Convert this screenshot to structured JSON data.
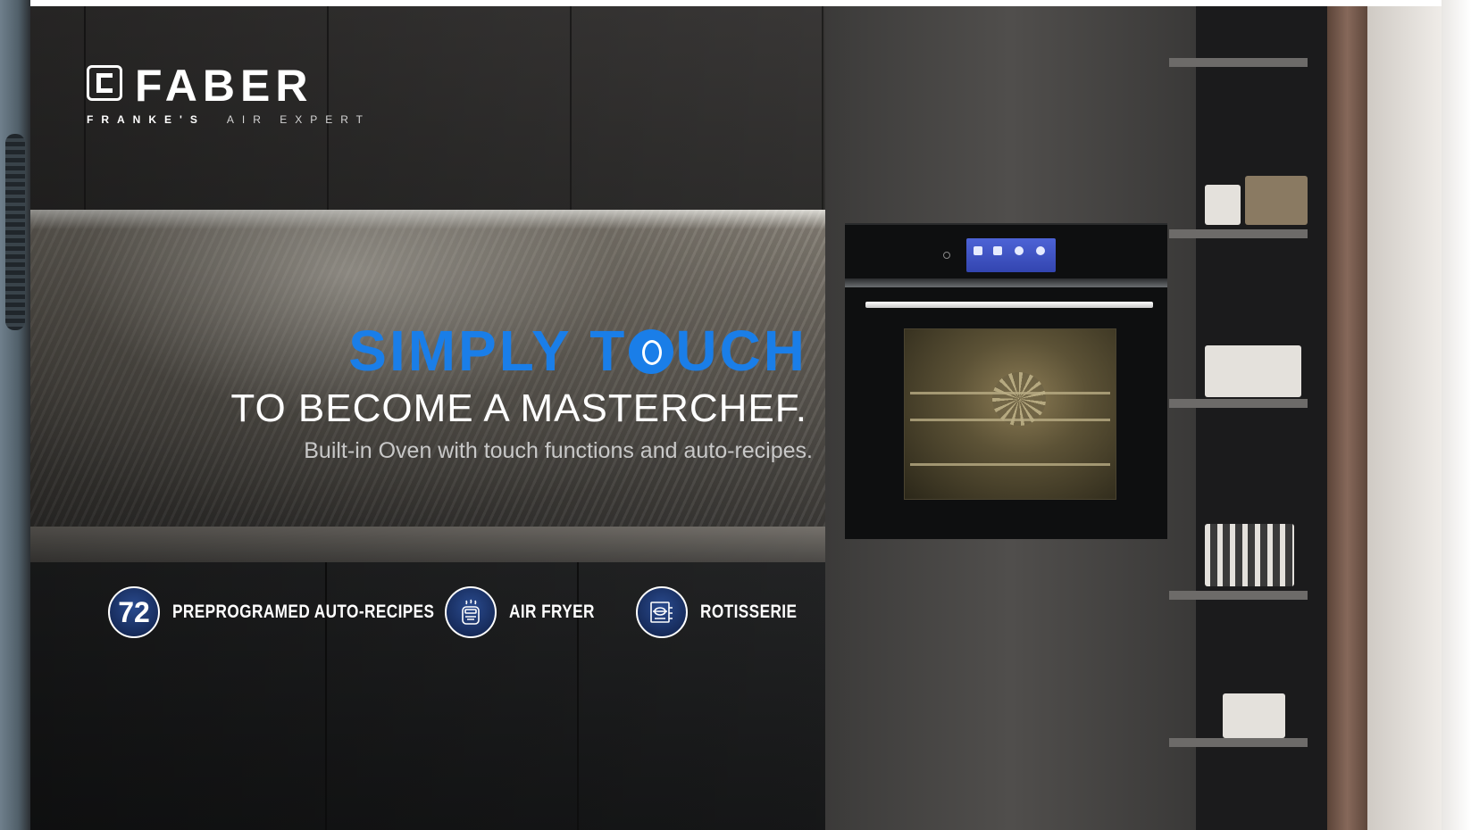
{
  "brand": {
    "name": "FABER",
    "tagline_bold": "FRANKE'S",
    "tagline_light": "AIR EXPERT"
  },
  "headline": {
    "line1_part1": "SIMPLY T",
    "line1_part2": "UCH",
    "line2": "TO BECOME A MASTERCHEF.",
    "line3": "Built-in Oven with touch functions and auto-recipes."
  },
  "features": [
    {
      "badge_text": "72",
      "label": "PREPROGRAMED AUTO-RECIPES"
    },
    {
      "icon": "air-fryer-icon",
      "label": "AIR FRYER"
    },
    {
      "icon": "rotisserie-icon",
      "label": "ROTISSERIE"
    }
  ],
  "colors": {
    "accent_blue": "#1a7ee8",
    "badge_navy": "#172c5c"
  }
}
